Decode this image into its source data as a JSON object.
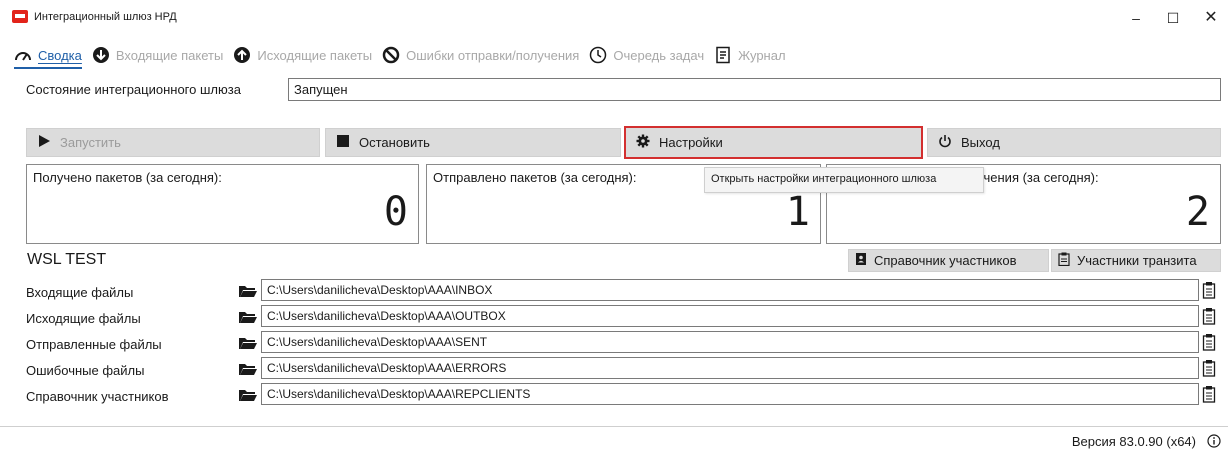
{
  "window": {
    "title": "Интеграционный шлюз НРД",
    "minimize": "–",
    "maximize": "☐",
    "close": "✕"
  },
  "tabs": [
    {
      "label": "Сводка",
      "icon": "gauge-icon",
      "active": true
    },
    {
      "label": "Входящие пакеты",
      "icon": "arrow-down-circle-icon",
      "active": false
    },
    {
      "label": "Исходящие пакеты",
      "icon": "arrow-up-circle-icon",
      "active": false
    },
    {
      "label": "Ошибки отправки/получения",
      "icon": "ban-icon",
      "active": false
    },
    {
      "label": "Очередь задач",
      "icon": "clock-icon",
      "active": false
    },
    {
      "label": "Журнал",
      "icon": "document-icon",
      "active": false
    }
  ],
  "status": {
    "label": "Состояние интеграционного шлюза",
    "value": "Запущен"
  },
  "actions": {
    "start": "Запустить",
    "stop": "Остановить",
    "settings": "Настройки",
    "exit": "Выход"
  },
  "counters": {
    "received_label": "Получено пакетов (за сегодня):",
    "received_value": "0",
    "sent_label": "Отправлено пакетов (за сегодня):",
    "sent_value": "1",
    "errors_label": "учения (за сегодня):",
    "errors_value": "2"
  },
  "tooltip": "Открыть настройки интеграционного шлюза",
  "profile": {
    "name": "WSL TEST",
    "participants_button": "Справочник участников",
    "transit_button": "Участники транзита"
  },
  "paths": [
    {
      "label": "Входящие файлы",
      "value": "C:\\Users\\danilicheva\\Desktop\\AAA\\INBOX"
    },
    {
      "label": "Исходящие файлы",
      "value": "C:\\Users\\danilicheva\\Desktop\\AAA\\OUTBOX"
    },
    {
      "label": "Отправленные файлы",
      "value": "C:\\Users\\danilicheva\\Desktop\\AAA\\SENT"
    },
    {
      "label": "Ошибочные файлы",
      "value": "C:\\Users\\danilicheva\\Desktop\\AAA\\ERRORS"
    },
    {
      "label": "Справочник участников",
      "value": "C:\\Users\\danilicheva\\Desktop\\AAA\\REPCLIENTS"
    }
  ],
  "footer": {
    "version": "Версия 83.0.90 (x64)"
  },
  "colors": {
    "accent": "#1f5fa8",
    "brand_red": "#e2231a",
    "focus_border": "#d32f2f"
  }
}
